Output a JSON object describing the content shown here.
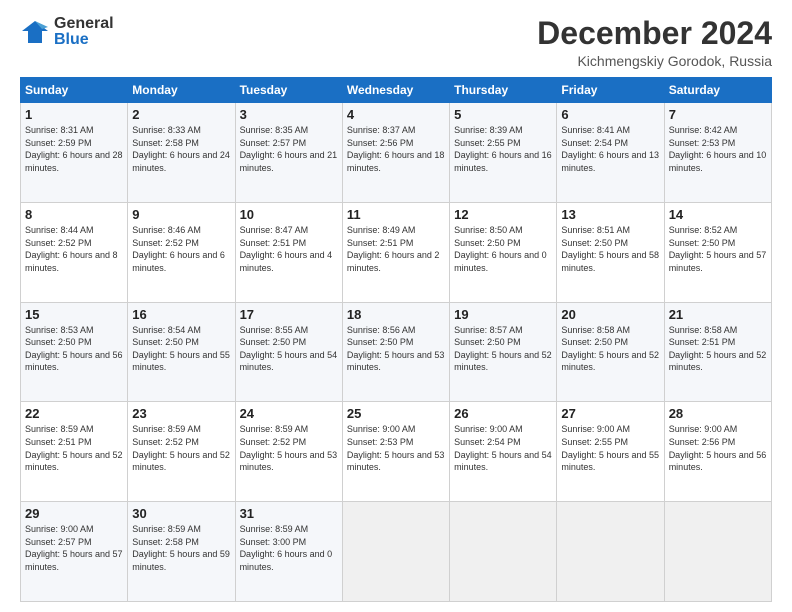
{
  "header": {
    "logo_general": "General",
    "logo_blue": "Blue",
    "month_title": "December 2024",
    "location": "Kichmengskiy Gorodok, Russia"
  },
  "weekdays": [
    "Sunday",
    "Monday",
    "Tuesday",
    "Wednesday",
    "Thursday",
    "Friday",
    "Saturday"
  ],
  "weeks": [
    [
      {
        "day": "1",
        "sunrise": "Sunrise: 8:31 AM",
        "sunset": "Sunset: 2:59 PM",
        "daylight": "Daylight: 6 hours and 28 minutes."
      },
      {
        "day": "2",
        "sunrise": "Sunrise: 8:33 AM",
        "sunset": "Sunset: 2:58 PM",
        "daylight": "Daylight: 6 hours and 24 minutes."
      },
      {
        "day": "3",
        "sunrise": "Sunrise: 8:35 AM",
        "sunset": "Sunset: 2:57 PM",
        "daylight": "Daylight: 6 hours and 21 minutes."
      },
      {
        "day": "4",
        "sunrise": "Sunrise: 8:37 AM",
        "sunset": "Sunset: 2:56 PM",
        "daylight": "Daylight: 6 hours and 18 minutes."
      },
      {
        "day": "5",
        "sunrise": "Sunrise: 8:39 AM",
        "sunset": "Sunset: 2:55 PM",
        "daylight": "Daylight: 6 hours and 16 minutes."
      },
      {
        "day": "6",
        "sunrise": "Sunrise: 8:41 AM",
        "sunset": "Sunset: 2:54 PM",
        "daylight": "Daylight: 6 hours and 13 minutes."
      },
      {
        "day": "7",
        "sunrise": "Sunrise: 8:42 AM",
        "sunset": "Sunset: 2:53 PM",
        "daylight": "Daylight: 6 hours and 10 minutes."
      }
    ],
    [
      {
        "day": "8",
        "sunrise": "Sunrise: 8:44 AM",
        "sunset": "Sunset: 2:52 PM",
        "daylight": "Daylight: 6 hours and 8 minutes."
      },
      {
        "day": "9",
        "sunrise": "Sunrise: 8:46 AM",
        "sunset": "Sunset: 2:52 PM",
        "daylight": "Daylight: 6 hours and 6 minutes."
      },
      {
        "day": "10",
        "sunrise": "Sunrise: 8:47 AM",
        "sunset": "Sunset: 2:51 PM",
        "daylight": "Daylight: 6 hours and 4 minutes."
      },
      {
        "day": "11",
        "sunrise": "Sunrise: 8:49 AM",
        "sunset": "Sunset: 2:51 PM",
        "daylight": "Daylight: 6 hours and 2 minutes."
      },
      {
        "day": "12",
        "sunrise": "Sunrise: 8:50 AM",
        "sunset": "Sunset: 2:50 PM",
        "daylight": "Daylight: 6 hours and 0 minutes."
      },
      {
        "day": "13",
        "sunrise": "Sunrise: 8:51 AM",
        "sunset": "Sunset: 2:50 PM",
        "daylight": "Daylight: 5 hours and 58 minutes."
      },
      {
        "day": "14",
        "sunrise": "Sunrise: 8:52 AM",
        "sunset": "Sunset: 2:50 PM",
        "daylight": "Daylight: 5 hours and 57 minutes."
      }
    ],
    [
      {
        "day": "15",
        "sunrise": "Sunrise: 8:53 AM",
        "sunset": "Sunset: 2:50 PM",
        "daylight": "Daylight: 5 hours and 56 minutes."
      },
      {
        "day": "16",
        "sunrise": "Sunrise: 8:54 AM",
        "sunset": "Sunset: 2:50 PM",
        "daylight": "Daylight: 5 hours and 55 minutes."
      },
      {
        "day": "17",
        "sunrise": "Sunrise: 8:55 AM",
        "sunset": "Sunset: 2:50 PM",
        "daylight": "Daylight: 5 hours and 54 minutes."
      },
      {
        "day": "18",
        "sunrise": "Sunrise: 8:56 AM",
        "sunset": "Sunset: 2:50 PM",
        "daylight": "Daylight: 5 hours and 53 minutes."
      },
      {
        "day": "19",
        "sunrise": "Sunrise: 8:57 AM",
        "sunset": "Sunset: 2:50 PM",
        "daylight": "Daylight: 5 hours and 52 minutes."
      },
      {
        "day": "20",
        "sunrise": "Sunrise: 8:58 AM",
        "sunset": "Sunset: 2:50 PM",
        "daylight": "Daylight: 5 hours and 52 minutes."
      },
      {
        "day": "21",
        "sunrise": "Sunrise: 8:58 AM",
        "sunset": "Sunset: 2:51 PM",
        "daylight": "Daylight: 5 hours and 52 minutes."
      }
    ],
    [
      {
        "day": "22",
        "sunrise": "Sunrise: 8:59 AM",
        "sunset": "Sunset: 2:51 PM",
        "daylight": "Daylight: 5 hours and 52 minutes."
      },
      {
        "day": "23",
        "sunrise": "Sunrise: 8:59 AM",
        "sunset": "Sunset: 2:52 PM",
        "daylight": "Daylight: 5 hours and 52 minutes."
      },
      {
        "day": "24",
        "sunrise": "Sunrise: 8:59 AM",
        "sunset": "Sunset: 2:52 PM",
        "daylight": "Daylight: 5 hours and 53 minutes."
      },
      {
        "day": "25",
        "sunrise": "Sunrise: 9:00 AM",
        "sunset": "Sunset: 2:53 PM",
        "daylight": "Daylight: 5 hours and 53 minutes."
      },
      {
        "day": "26",
        "sunrise": "Sunrise: 9:00 AM",
        "sunset": "Sunset: 2:54 PM",
        "daylight": "Daylight: 5 hours and 54 minutes."
      },
      {
        "day": "27",
        "sunrise": "Sunrise: 9:00 AM",
        "sunset": "Sunset: 2:55 PM",
        "daylight": "Daylight: 5 hours and 55 minutes."
      },
      {
        "day": "28",
        "sunrise": "Sunrise: 9:00 AM",
        "sunset": "Sunset: 2:56 PM",
        "daylight": "Daylight: 5 hours and 56 minutes."
      }
    ],
    [
      {
        "day": "29",
        "sunrise": "Sunrise: 9:00 AM",
        "sunset": "Sunset: 2:57 PM",
        "daylight": "Daylight: 5 hours and 57 minutes."
      },
      {
        "day": "30",
        "sunrise": "Sunrise: 8:59 AM",
        "sunset": "Sunset: 2:58 PM",
        "daylight": "Daylight: 5 hours and 59 minutes."
      },
      {
        "day": "31",
        "sunrise": "Sunrise: 8:59 AM",
        "sunset": "Sunset: 3:00 PM",
        "daylight": "Daylight: 6 hours and 0 minutes."
      },
      {
        "day": "",
        "sunrise": "",
        "sunset": "",
        "daylight": ""
      },
      {
        "day": "",
        "sunrise": "",
        "sunset": "",
        "daylight": ""
      },
      {
        "day": "",
        "sunrise": "",
        "sunset": "",
        "daylight": ""
      },
      {
        "day": "",
        "sunrise": "",
        "sunset": "",
        "daylight": ""
      }
    ]
  ]
}
